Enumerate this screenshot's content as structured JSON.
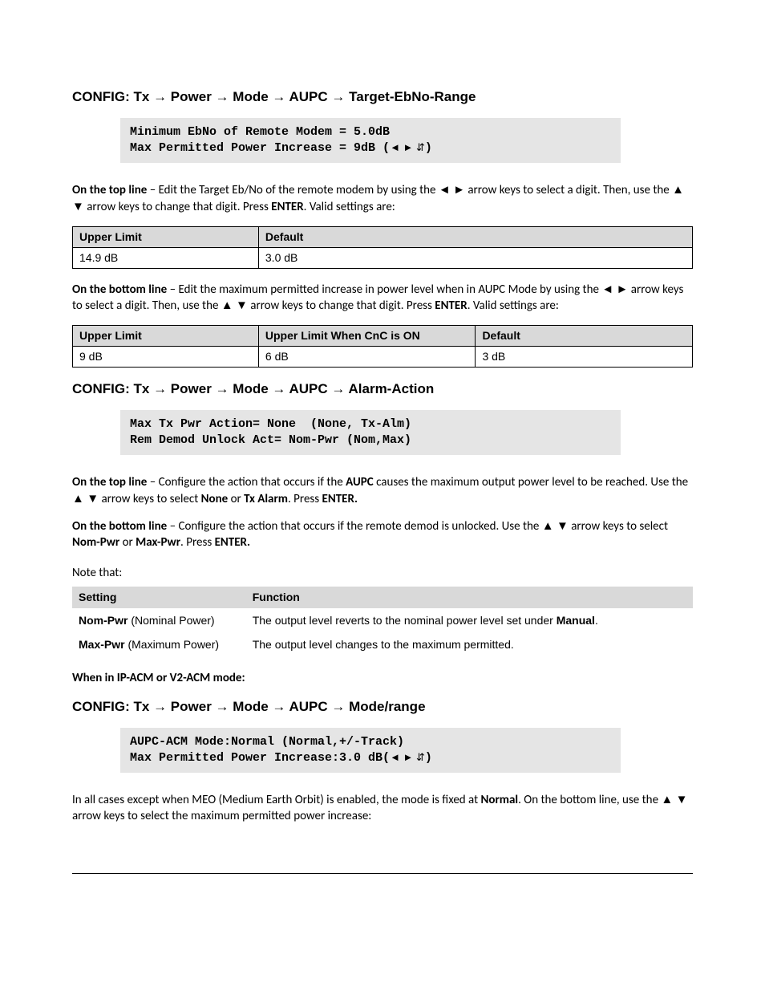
{
  "section1": {
    "heading_parts": [
      "CONFIG: Tx",
      "Power",
      "Mode",
      "AUPC",
      "Target-EbNo-Range"
    ],
    "display_line1": "Minimum EbNo of Remote Modem = 5.0dB",
    "display_line2_pre": "Max Permitted Power Increase = 9dB (",
    "display_line2_post": ")",
    "para_top_1": "On the top line",
    "para_top_2": " – Edit the Target Eb/No of the remote modem by using the ◄ ► arrow keys to select a digit. Then, use the ▲ ▼ arrow keys to change that digit. Press ",
    "para_top_3": "ENTER",
    "para_top_4": ". Valid settings are:",
    "table1": {
      "h1": "Upper Limit",
      "h2": "Default",
      "c1": "14.9 dB",
      "c2": "3.0 dB"
    },
    "para_bot_1": "On the bottom line",
    "para_bot_2": " – Edit the maximum permitted increase in power level when in AUPC Mode by using the ◄ ► arrow keys to select a digit. Then, use the ▲ ▼ arrow keys to change that digit. Press ",
    "para_bot_3": "ENTER",
    "para_bot_4": ". Valid settings are:",
    "table2": {
      "h1": "Upper Limit",
      "h2": "Upper Limit When CnC is ON",
      "h3": "Default",
      "c1": "9 dB",
      "c2": "6 dB",
      "c3": "3 dB"
    }
  },
  "section2": {
    "heading_parts": [
      "CONFIG: Tx",
      "Power",
      "Mode",
      "AUPC",
      "Alarm-Action"
    ],
    "display_line1": "Max Tx Pwr Action= None  (None, Tx-Alm)",
    "display_line2": "Rem Demod Unlock Act= Nom-Pwr (Nom,Max)",
    "para_top_1": "On the top line",
    "para_top_2": " – Configure the action that occurs if the ",
    "para_top_3": "AUPC",
    "para_top_4": " causes the maximum output power level to be reached. Use the ▲ ▼ arrow keys to select ",
    "para_top_5": "None",
    "para_top_6": " or ",
    "para_top_7": "Tx Alarm",
    "para_top_8": ". Press ",
    "para_top_9": "ENTER.",
    "para_bot_1": "On the bottom line",
    "para_bot_2": " – Configure the action that occurs if the remote demod is unlocked. Use the ▲ ▼ arrow keys to select ",
    "para_bot_3": "Nom-Pwr",
    "para_bot_4": " or ",
    "para_bot_5": "Max-Pwr",
    "para_bot_6": ". Press ",
    "para_bot_7": "ENTER.",
    "note": "Note that:",
    "table3": {
      "h1": "Setting",
      "h2": "Function",
      "r1c1a": "Nom-Pwr",
      "r1c1b": " (Nominal Power)",
      "r1c2a": "The output level reverts to the nominal power level set under ",
      "r1c2b": "Manual",
      "r1c2c": ".",
      "r2c1a": "Max-Pwr",
      "r2c1b": " (Maximum Power)",
      "r2c2": "The output level changes to the maximum permitted."
    },
    "mode_note": "When in IP-ACM or V2-ACM mode:"
  },
  "section3": {
    "heading_parts": [
      "CONFIG: Tx",
      "Power",
      "Mode",
      "AUPC",
      "Mode/range"
    ],
    "display_line1": "AUPC-ACM Mode:Normal (Normal,+/-Track)",
    "display_line2_pre": "Max Permitted Power Increase:3.0 dB(",
    "display_line2_post": ")",
    "para_1": "In all cases except when MEO (Medium Earth Orbit) is enabled, the mode is fixed at ",
    "para_2": "Normal",
    "para_3": ". On the bottom line, use the ▲ ▼ arrow keys to select the maximum permitted power increase:"
  },
  "arrow_sep": " → "
}
